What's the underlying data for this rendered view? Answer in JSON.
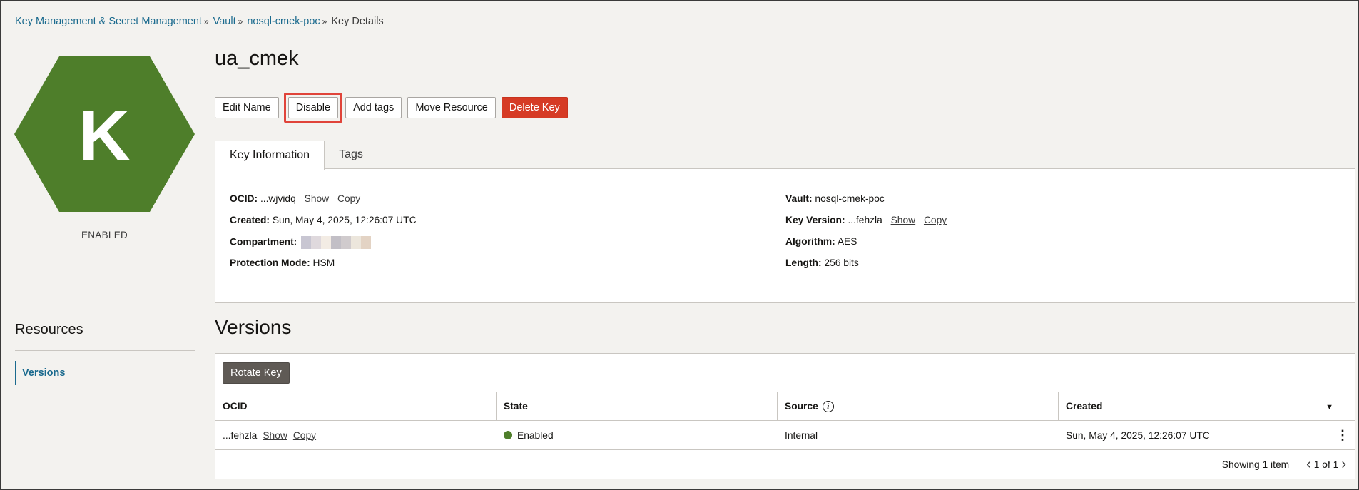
{
  "breadcrumb": {
    "items": [
      "Key Management & Secret Management",
      "Vault",
      "nosql-cmek-poc"
    ],
    "current": "Key Details",
    "separator": "»"
  },
  "resource": {
    "letter": "K",
    "status": "ENABLED",
    "hex_color": "#4e7e2a"
  },
  "sidebar": {
    "title": "Resources",
    "items": [
      {
        "label": "Versions"
      }
    ]
  },
  "page": {
    "title": "ua_cmek"
  },
  "actions": {
    "edit_name": "Edit Name",
    "disable": "Disable",
    "add_tags": "Add tags",
    "move_resource": "Move Resource",
    "delete_key": "Delete Key"
  },
  "tabs": [
    {
      "label": "Key Information",
      "active": true
    },
    {
      "label": "Tags",
      "active": false
    }
  ],
  "key_info": {
    "ocid": {
      "label": "OCID:",
      "value": "...wjvidq",
      "show": "Show",
      "copy": "Copy"
    },
    "created": {
      "label": "Created:",
      "value": "Sun, May 4, 2025, 12:26:07 UTC"
    },
    "compartment": {
      "label": "Compartment:",
      "redacted_colors": [
        "#c8c6d2",
        "#dfd9dd",
        "#f3ece4",
        "#c2bfc6",
        "#d0cbcd",
        "#ece6dc",
        "#e3d3c4"
      ]
    },
    "protection_mode": {
      "label": "Protection Mode:",
      "value": "HSM"
    },
    "vault": {
      "label": "Vault:",
      "value": "nosql-cmek-poc"
    },
    "key_version": {
      "label": "Key Version:",
      "value": "...fehzla",
      "show": "Show",
      "copy": "Copy"
    },
    "algorithm": {
      "label": "Algorithm:",
      "value": "AES"
    },
    "length": {
      "label": "Length:",
      "value": "256 bits"
    }
  },
  "versions": {
    "title": "Versions",
    "rotate_label": "Rotate Key",
    "columns": [
      "OCID",
      "State",
      "Source",
      "Created"
    ],
    "rows": [
      {
        "ocid": "...fehzla",
        "show": "Show",
        "copy": "Copy",
        "state": "Enabled",
        "source": "Internal",
        "created": "Sun, May 4, 2025, 12:26:07 UTC"
      }
    ],
    "showing": "Showing 1 item",
    "page": "1 of 1"
  }
}
